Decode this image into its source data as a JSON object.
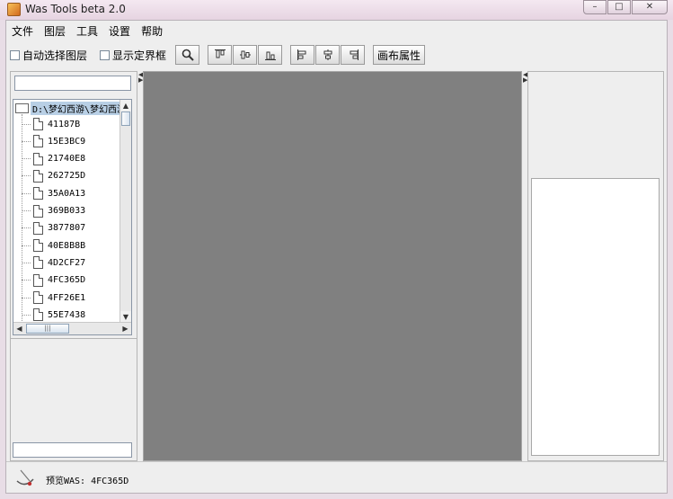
{
  "window": {
    "title": "Was Tools beta 2.0",
    "controls": [
      "–",
      "□",
      "✕"
    ]
  },
  "menubar": [
    "文件",
    "图层",
    "工具",
    "设置",
    "帮助"
  ],
  "toolbar": {
    "auto_select_label": "自动选择图层",
    "show_bounds_label": "显示定界框",
    "canvas_props_label": "画布属性"
  },
  "tree": {
    "root": "D:\\梦幻西游\\梦幻西游",
    "nodes": [
      "41187B",
      "15E3BC9",
      "21740E8",
      "262725D",
      "35A0A13",
      "369B033",
      "3877807",
      "40E8B8B",
      "4D2CF27",
      "4FC365D",
      "4FF26E1",
      "55E7438"
    ]
  },
  "status": {
    "text": "预览WAS: 4FC365D"
  }
}
